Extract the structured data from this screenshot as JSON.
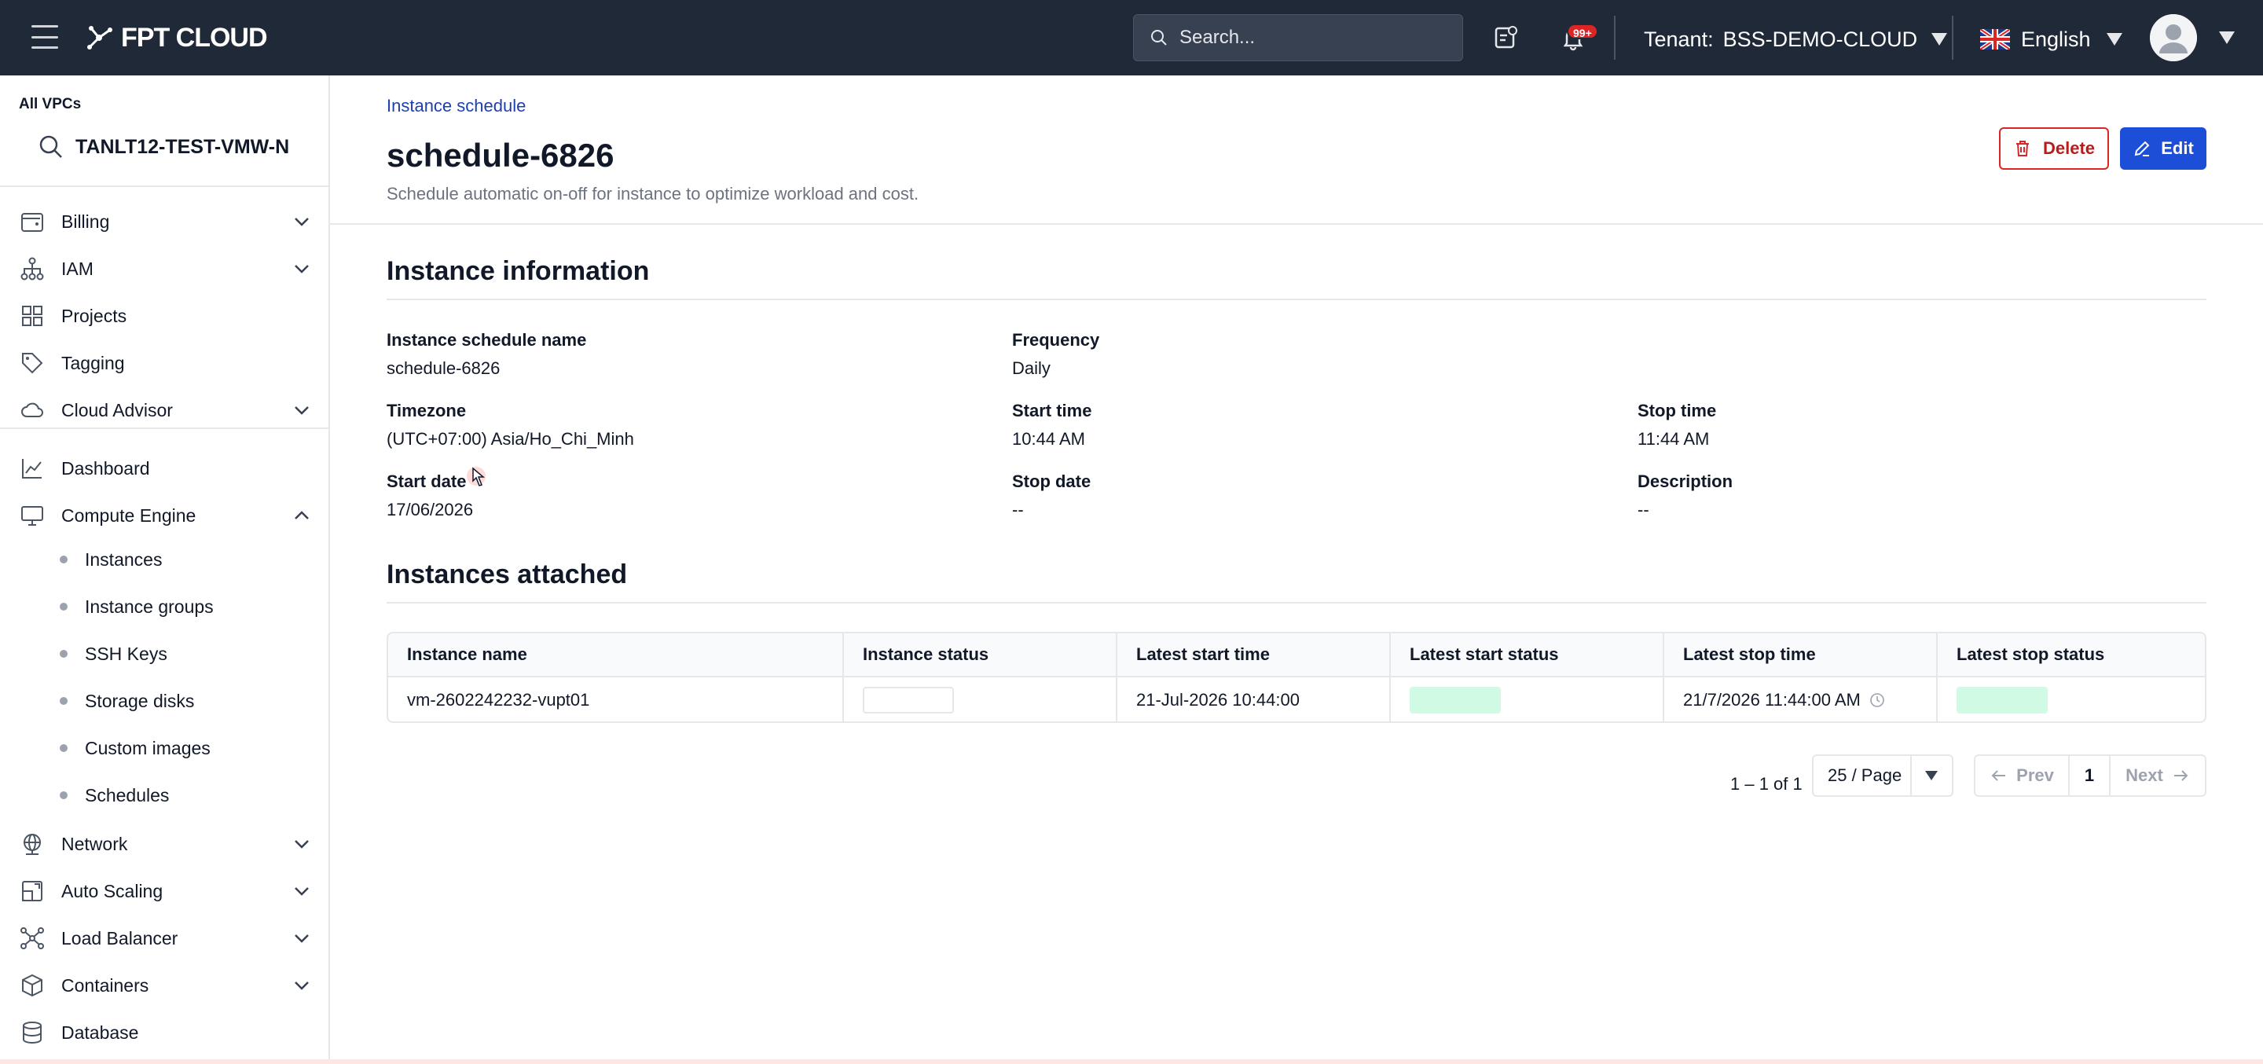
{
  "topbar": {
    "brand": "FPT CLOUD",
    "search_placeholder": "Search...",
    "notification_badge": "99+",
    "tenant_label": "Tenant:",
    "tenant_value": "BSS-DEMO-CLOUD",
    "language": "English"
  },
  "sidebar": {
    "vpc_label": "All VPCs",
    "vpc_value": "TANLT12-TEST-VMW-N",
    "items": [
      {
        "label": "Billing",
        "icon": "wallet-icon"
      },
      {
        "label": "IAM",
        "icon": "hierarchy-icon"
      },
      {
        "label": "Projects",
        "icon": "grid-icon"
      },
      {
        "label": "Tagging",
        "icon": "tag-icon"
      },
      {
        "label": "Cloud Advisor",
        "icon": "cloud-icon"
      },
      {
        "label": "Dashboard",
        "icon": "chart-icon"
      },
      {
        "label": "Compute Engine",
        "icon": "monitor-icon"
      },
      {
        "label": "Network",
        "icon": "globe-icon"
      },
      {
        "label": "Auto Scaling",
        "icon": "scale-icon"
      },
      {
        "label": "Load Balancer",
        "icon": "network-icon"
      },
      {
        "label": "Containers",
        "icon": "box-icon"
      },
      {
        "label": "Database",
        "icon": "database-icon"
      }
    ],
    "compute_sub": [
      "Instances",
      "Instance groups",
      "SSH Keys",
      "Storage disks",
      "Custom images",
      "Schedules"
    ]
  },
  "page": {
    "breadcrumb": "Instance schedule",
    "title": "schedule-6826",
    "subtitle": "Schedule automatic on-off for instance to optimize workload and cost.",
    "delete_label": "Delete",
    "edit_label": "Edit"
  },
  "info": {
    "section_title": "Instance information",
    "fields": {
      "name_label": "Instance schedule name",
      "name_value": "schedule-6826",
      "frequency_label": "Frequency",
      "frequency_value": "Daily",
      "timezone_label": "Timezone",
      "timezone_value": "(UTC+07:00) Asia/Ho_Chi_Minh",
      "start_time_label": "Start time",
      "start_time_value": "10:44 AM",
      "stop_time_label": "Stop time",
      "stop_time_value": "11:44 AM",
      "start_date_label": "Start date",
      "start_date_value": "17/06/2026",
      "stop_date_label": "Stop date",
      "stop_date_value": "--",
      "description_label": "Description",
      "description_value": "--"
    }
  },
  "attached": {
    "section_title": "Instances attached",
    "columns": [
      "Instance name",
      "Instance status",
      "Latest start time",
      "Latest start status",
      "Latest stop time",
      "Latest stop status"
    ],
    "rows": [
      {
        "name": "vm-2602242232-vupt01",
        "latest_start_time": "21-Jul-2026 10:44:00",
        "latest_stop_time": "21/7/2026 11:44:00 AM"
      }
    ]
  },
  "pagination": {
    "count": "1 – 1 of 1",
    "page_size": "25 / Page",
    "prev": "Prev",
    "current": "1",
    "next": "Next"
  },
  "colors": {
    "topbar": "#1f2937",
    "accent": "#1d4ed8",
    "danger": "#dc2626",
    "success_bg": "#d1fae5"
  }
}
